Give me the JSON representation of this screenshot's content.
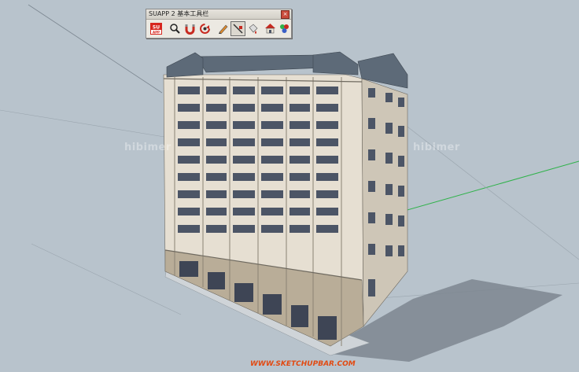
{
  "toolbar": {
    "title": "SUAPP 2 基本工具栏",
    "close_glyph": "×",
    "buttons": [
      {
        "name": "suapp-logo-icon",
        "label": "SU",
        "sublabel": "APP"
      },
      {
        "name": "magnify-icon"
      },
      {
        "name": "magnet-icon"
      },
      {
        "name": "rotate-icon"
      },
      {
        "name": "pencil-icon"
      },
      {
        "name": "line-tool-icon"
      },
      {
        "name": "paint-icon"
      },
      {
        "name": "house-icon"
      },
      {
        "name": "components-icon"
      }
    ]
  },
  "watermarks": [
    "hibimer",
    "hibimer"
  ],
  "footer": {
    "site": "WWW.SKETCHUPBAR.COM"
  },
  "colors": {
    "background": "#b8c3cc",
    "axis_green": "#2fb24a",
    "axis_red": "#c0392b",
    "axis_blue": "#3a5fc6",
    "roof": "#5d6a78",
    "wall": "#e4ddd0",
    "accent_orange": "#e24a12"
  }
}
